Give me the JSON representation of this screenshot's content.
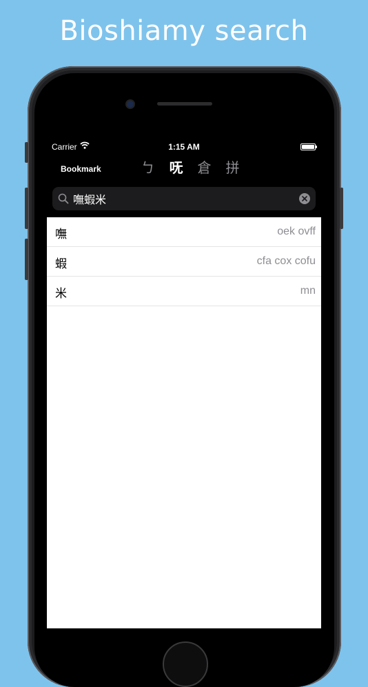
{
  "promo": {
    "title": "Bioshiamy search"
  },
  "status_bar": {
    "carrier": "Carrier",
    "time": "1:15 AM"
  },
  "nav": {
    "bookmark_label": "Bookmark",
    "segments": [
      {
        "label": "ㄅ",
        "active": false
      },
      {
        "label": "呒",
        "active": true
      },
      {
        "label": "倉",
        "active": false
      },
      {
        "label": "拼",
        "active": false
      }
    ]
  },
  "search": {
    "value": "嘸蝦米",
    "placeholder": ""
  },
  "results": [
    {
      "char": "嘸",
      "code": "oek ovff"
    },
    {
      "char": "蝦",
      "code": "cfa cox cofu"
    },
    {
      "char": "米",
      "code": "mn"
    }
  ],
  "colors": {
    "background": "#7ec3ec",
    "phone_body": "#1d1d1f",
    "screen_bg": "#000000",
    "active_segment": "#ffffff",
    "inactive_segment": "#8e8e93",
    "code_text": "#8e8e93"
  }
}
